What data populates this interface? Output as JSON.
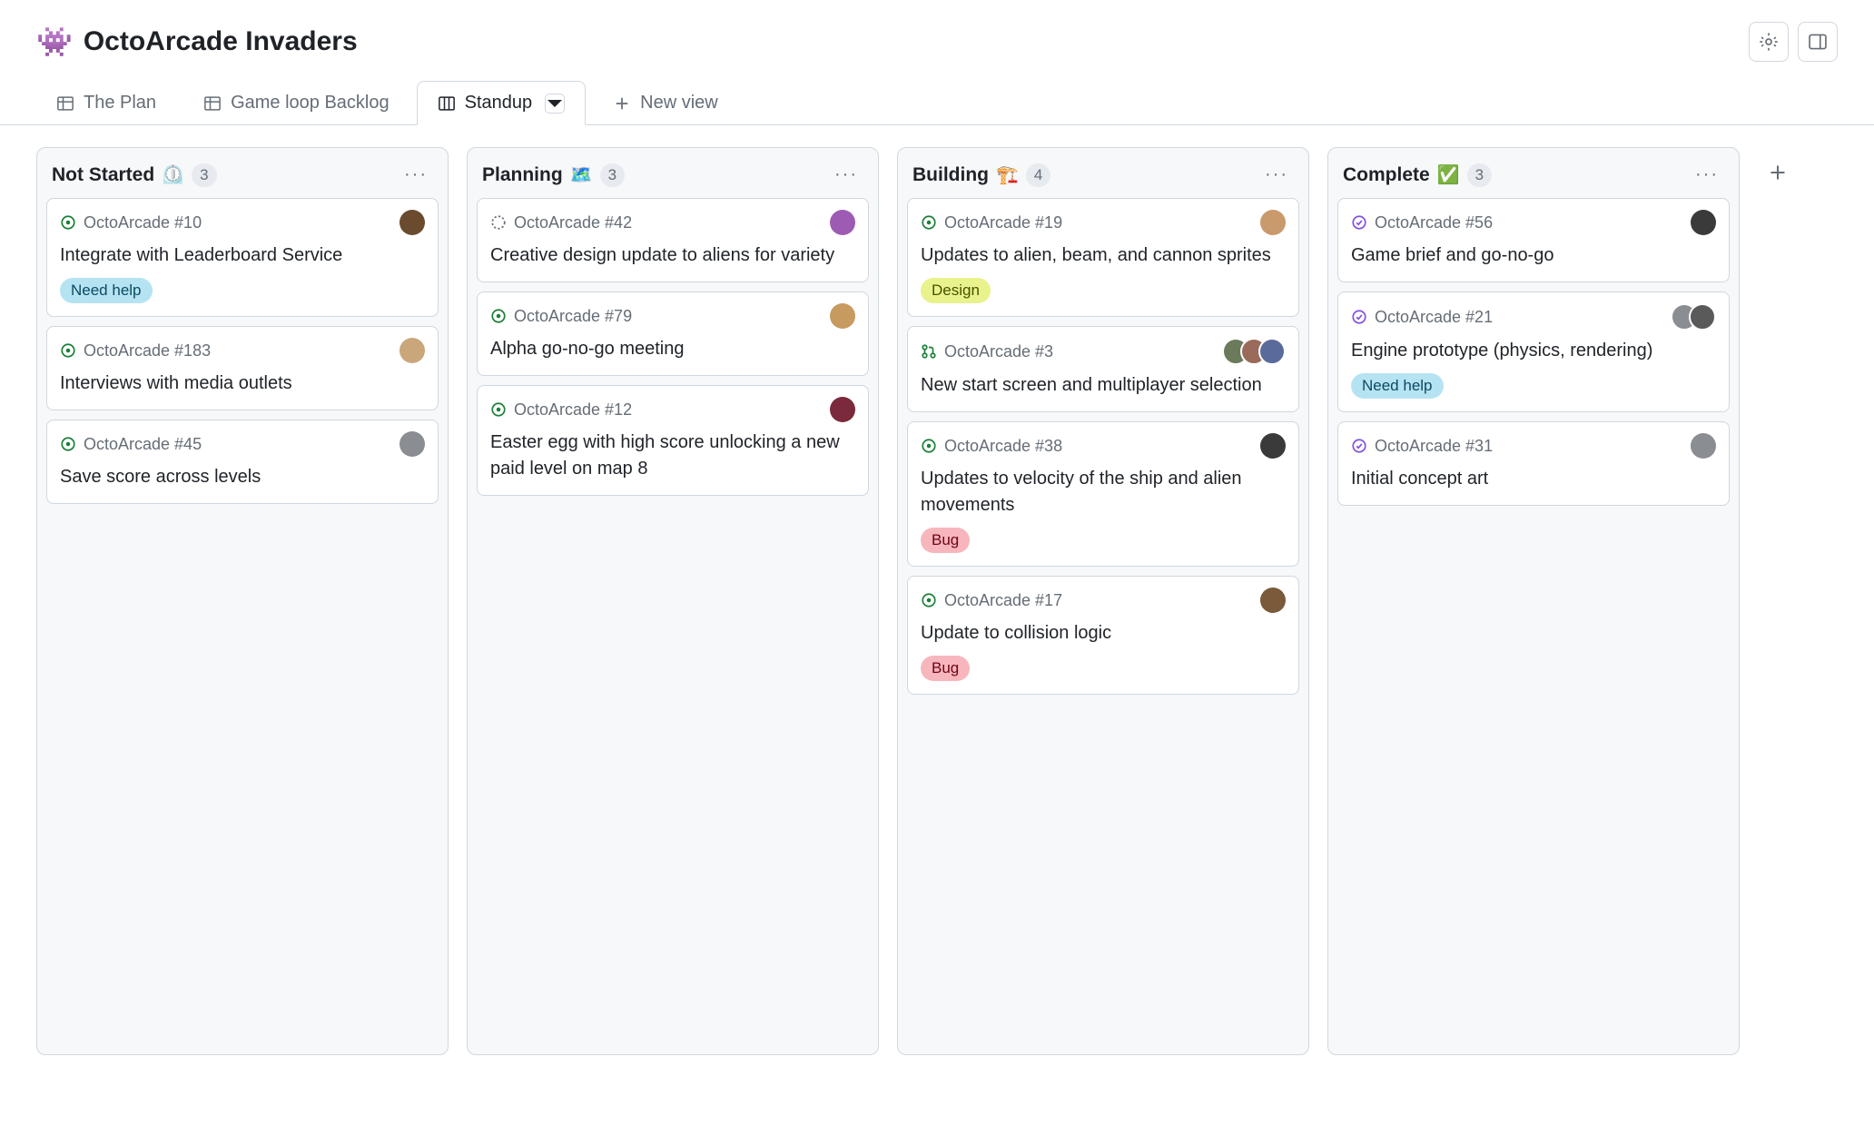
{
  "header": {
    "icon": "👾",
    "title": "OctoArcade Invaders"
  },
  "tabs": {
    "plan": "The Plan",
    "backlog": "Game loop Backlog",
    "standup": "Standup",
    "new_view": "New view"
  },
  "labels": {
    "need_help": "Need help",
    "design": "Design",
    "bug": "Bug"
  },
  "columns": {
    "not_started": {
      "title": "Not Started",
      "emoji": "⏲️",
      "count": "3",
      "cards": [
        {
          "ref": "OctoArcade #10",
          "title": "Integrate with Leaderboard Service",
          "label": "need_help",
          "avatar": "#6b4b2e",
          "status": "open"
        },
        {
          "ref": "OctoArcade #183",
          "title": "Interviews with media outlets",
          "avatar": "#c9a77a",
          "status": "open"
        },
        {
          "ref": "OctoArcade #45",
          "title": "Save score across levels",
          "avatar": "#8a8d91",
          "status": "open"
        }
      ]
    },
    "planning": {
      "title": "Planning",
      "emoji": "🗺️",
      "count": "3",
      "cards": [
        {
          "ref": "OctoArcade #42",
          "title": "Creative design update to aliens for variety",
          "avatar": "#9d5bb3",
          "status": "draft"
        },
        {
          "ref": "OctoArcade #79",
          "title": "Alpha go-no-go meeting",
          "avatar": "#c79a5f",
          "status": "open"
        },
        {
          "ref": "OctoArcade #12",
          "title": "Easter egg with high score unlocking a new paid level on map 8",
          "avatar": "#7a2a3a",
          "status": "open"
        }
      ]
    },
    "building": {
      "title": "Building",
      "emoji": "🏗️",
      "count": "4",
      "cards": [
        {
          "ref": "OctoArcade #19",
          "title": "Updates to alien, beam, and cannon sprites",
          "label": "design",
          "avatar": "#c99a6b",
          "status": "open"
        },
        {
          "ref": "OctoArcade #3",
          "title": "New start screen and multiplayer selection",
          "avatars": [
            "#6a7a5a",
            "#9a6a5a",
            "#5a6a9a"
          ],
          "status": "pr"
        },
        {
          "ref": "OctoArcade #38",
          "title": "Updates to velocity of the ship and alien movements",
          "label": "bug",
          "avatar": "#3a3a3a",
          "status": "open"
        },
        {
          "ref": "OctoArcade #17",
          "title": "Update to collision logic",
          "label": "bug",
          "avatar": "#7a5a3a",
          "status": "open"
        }
      ]
    },
    "complete": {
      "title": "Complete",
      "emoji": "✅",
      "count": "3",
      "cards": [
        {
          "ref": "OctoArcade #56",
          "title": "Game brief and go-no-go",
          "avatar": "#3a3a3a",
          "status": "closed"
        },
        {
          "ref": "OctoArcade #21",
          "title": "Engine prototype (physics, rendering)",
          "label": "need_help",
          "avatars": [
            "#8a8d91",
            "#5a5a5a"
          ],
          "status": "closed"
        },
        {
          "ref": "OctoArcade #31",
          "title": "Initial concept art",
          "avatar": "#8a8d91",
          "status": "closed"
        }
      ]
    }
  }
}
